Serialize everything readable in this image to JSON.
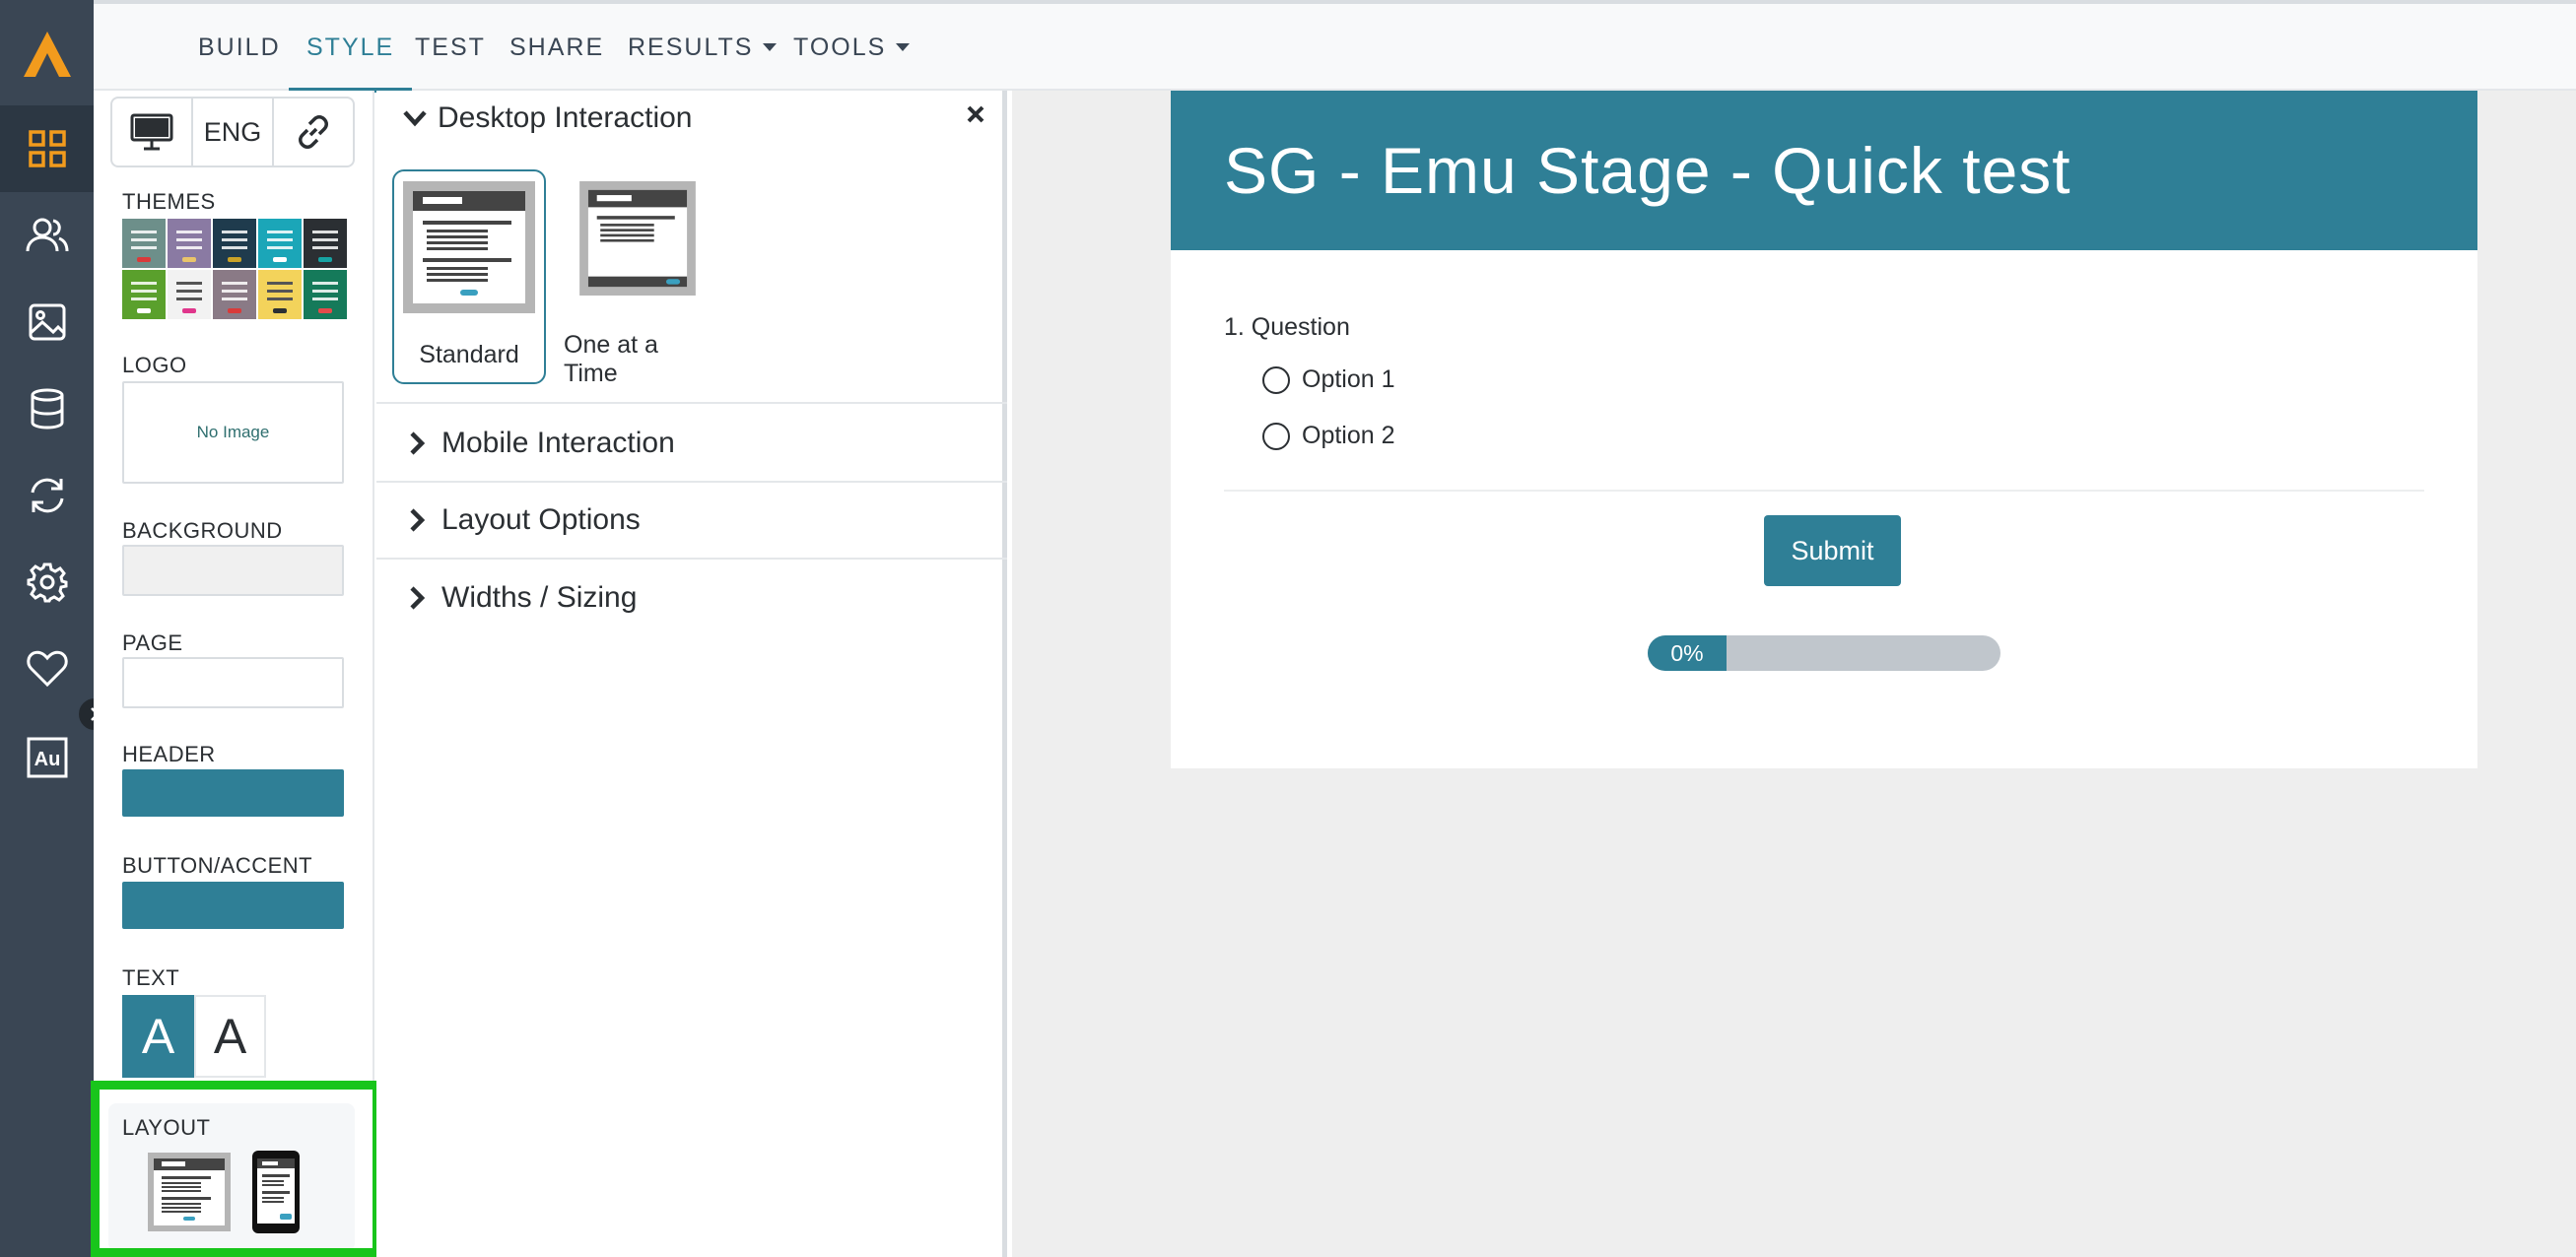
{
  "nav": {
    "tabs": [
      {
        "label": "BUILD"
      },
      {
        "label": "STYLE",
        "active": true
      },
      {
        "label": "TEST"
      },
      {
        "label": "SHARE"
      },
      {
        "label": "RESULTS",
        "dropdown": true
      },
      {
        "label": "TOOLS",
        "dropdown": true
      }
    ]
  },
  "rail": {
    "icons": [
      "grid-icon",
      "users-icon",
      "image-icon",
      "database-icon",
      "sync-icon",
      "gear-icon",
      "heart-icon",
      "au-icon"
    ],
    "active": "grid-icon",
    "au_text": "Au"
  },
  "style": {
    "lang": "ENG",
    "themes_label": "THEMES",
    "logo_label": "LOGO",
    "no_image": "No Image",
    "background_label": "BACKGROUND",
    "page_label": "PAGE",
    "header_label": "HEADER",
    "button_label": "BUTTON/ACCENT",
    "text_label": "TEXT",
    "text_dark": "A",
    "text_light": "A",
    "layout_label": "LAYOUT",
    "colors": {
      "background": "#f0f0f0",
      "page": "#ffffff",
      "header": "#2f7f96",
      "button": "#2f7f96"
    }
  },
  "interaction": {
    "desktop_title": "Desktop Interaction",
    "standard_label": "Standard",
    "one_at_a_time_label": "One at a Time",
    "mobile_title": "Mobile Interaction",
    "layout_options_title": "Layout Options",
    "widths_title": "Widths / Sizing"
  },
  "survey": {
    "title": "SG - Emu Stage - Quick test",
    "question": "1. Question",
    "options": [
      "Option 1",
      "Option 2"
    ],
    "submit": "Submit",
    "progress_text": "0%",
    "progress_fraction": 0.0
  },
  "colors": {
    "accent": "#2f7f96",
    "brand": "#f29b1d",
    "rail": "#3a4654",
    "highlight": "#18c51b"
  }
}
